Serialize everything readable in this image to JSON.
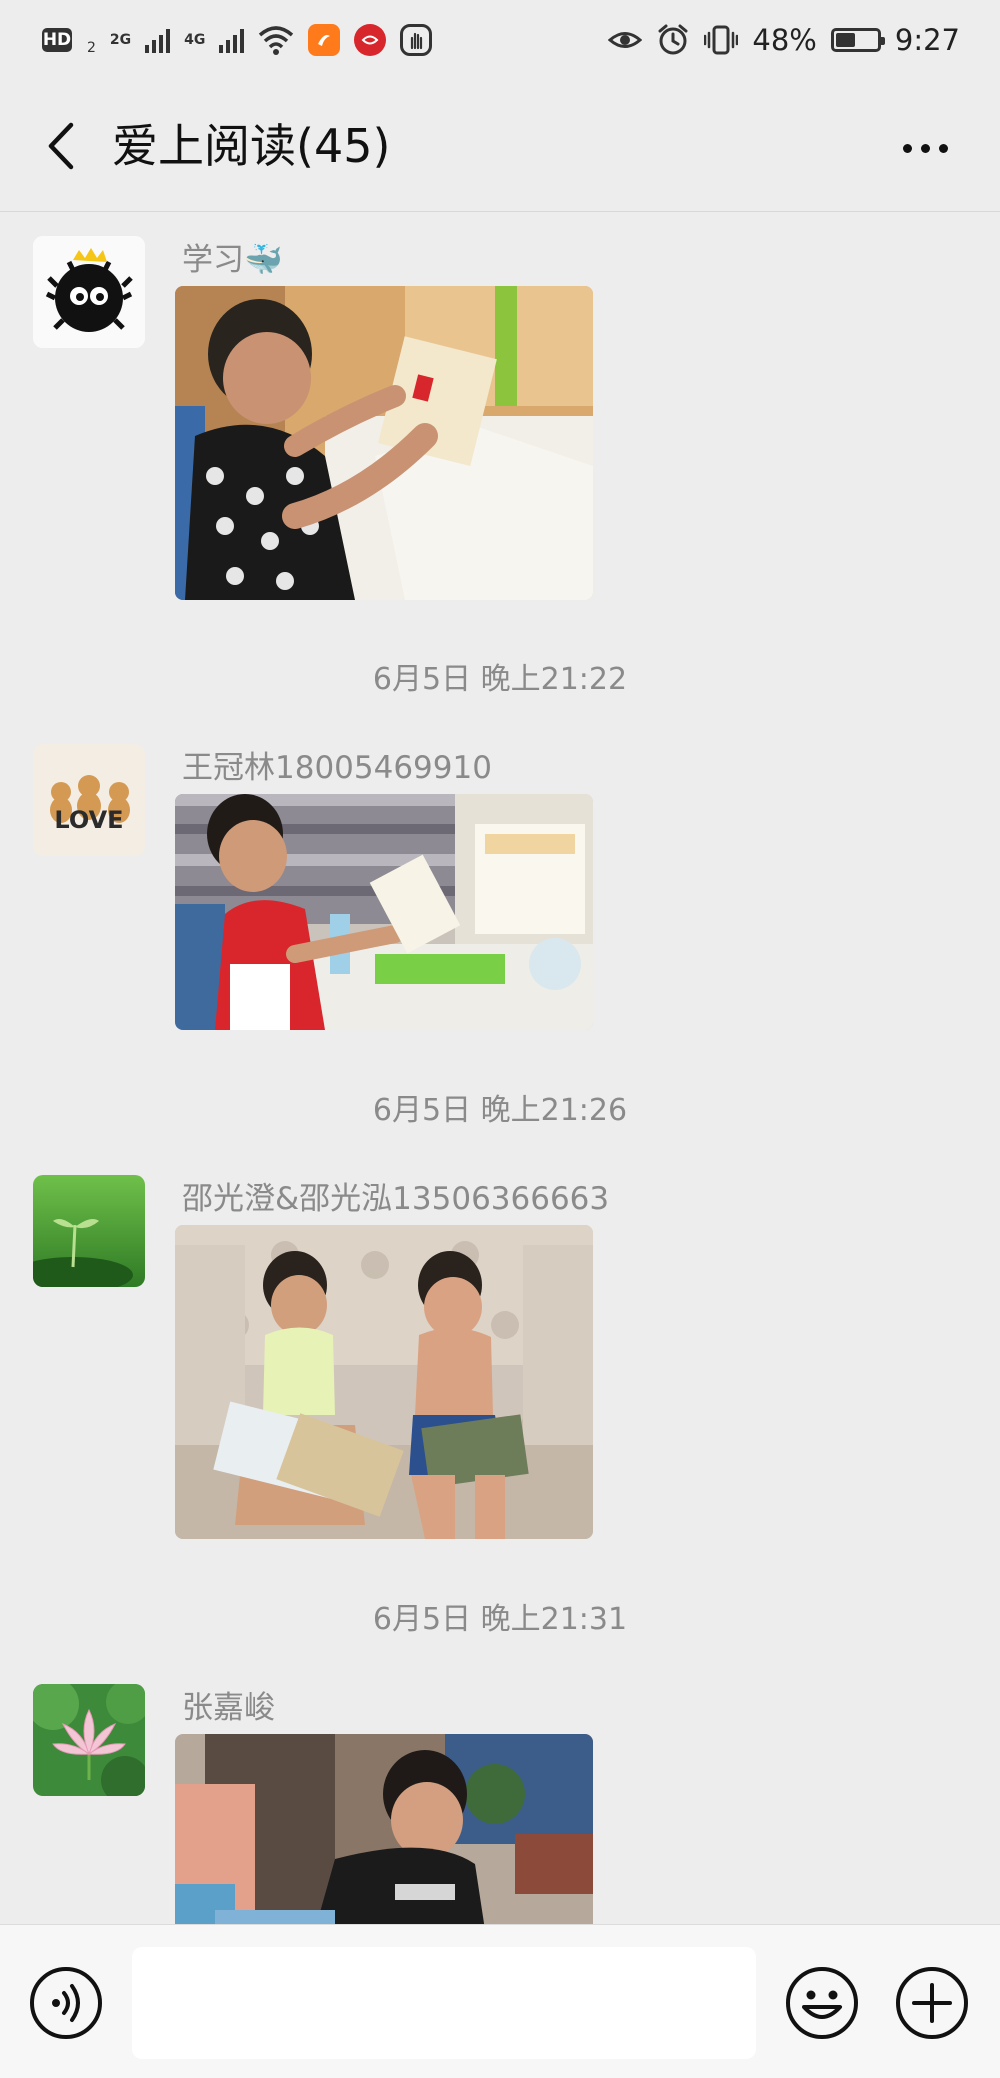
{
  "status_bar": {
    "hd_label": "HD",
    "hd_sub": "2",
    "net1_label": "2G",
    "net2_label": "4G",
    "battery_percent": "48%",
    "battery_level": 0.48,
    "time": "9:27"
  },
  "header": {
    "title": "爱上阅读(45)"
  },
  "messages": [
    {
      "sender": "学习",
      "sender_emoji": "🐳",
      "timestamp": ""
    },
    {
      "sender": "王冠林18005469910",
      "timestamp": "6月5日 晚上21:22"
    },
    {
      "sender": "邵光澄&邵光泓13506366663",
      "timestamp": "6月5日 晚上21:26"
    },
    {
      "sender": "张嘉峻",
      "timestamp": "6月5日 晚上21:31"
    }
  ],
  "avatar_labels": {
    "love": "LOVE"
  },
  "input": {
    "placeholder": "",
    "value": ""
  },
  "colors": {
    "background": "#ededed",
    "input_bar": "#f7f7f7",
    "meta_text": "#8a8a8a"
  }
}
